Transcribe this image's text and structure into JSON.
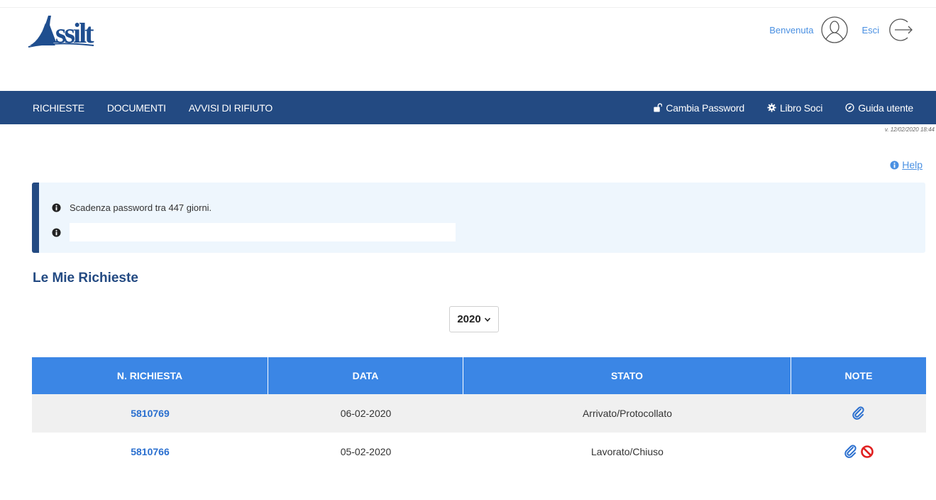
{
  "header": {
    "logo_text": "Assilt",
    "welcome_label": "Benvenuta",
    "logout_label": "Esci"
  },
  "nav": {
    "left": [
      "RICHIESTE",
      "DOCUMENTI",
      "AVVISI DI RIFIUTO"
    ],
    "right": {
      "change_password": "Cambia Password",
      "members_book": "Libro Soci",
      "user_guide": "Guida utente"
    }
  },
  "version": "v. 12/02/2020 18:44",
  "help_label": "Help",
  "info": {
    "password_expiry": "Scadenza password tra 447 giorni."
  },
  "section_title": "Le Mie Richieste",
  "year_filter": {
    "selected": "2020"
  },
  "table": {
    "headers": [
      "N. RICHIESTA",
      "DATA",
      "STATO",
      "NOTE"
    ],
    "rows": [
      {
        "number": "5810769",
        "date": "06-02-2020",
        "status": "Arrivato/Protocollato",
        "notes": [
          "paperclip-icon"
        ]
      },
      {
        "number": "5810766",
        "date": "05-02-2020",
        "status": "Lavorato/Chiuso",
        "notes": [
          "paperclip-icon",
          "ban-icon"
        ]
      }
    ]
  },
  "colors": {
    "navbar": "#234a82",
    "table_header": "#3b86e5",
    "link": "#2a6fcf",
    "info_bg": "#eef6fd",
    "ban": "#e02020"
  }
}
